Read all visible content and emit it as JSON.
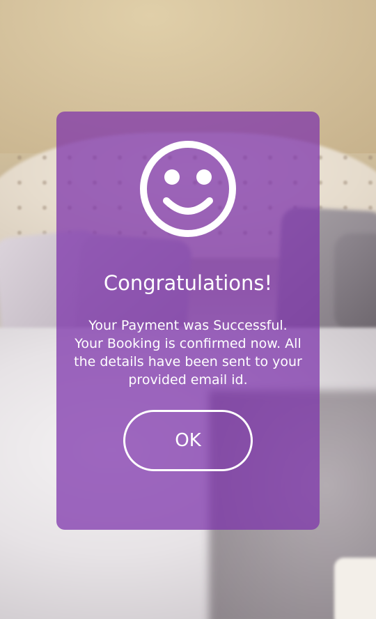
{
  "dialog": {
    "icon": "smiley-face-icon",
    "title": "Congratulations!",
    "message_lines": [
      "Your Payment was Successful.",
      "Your Booking is confirmed now. All",
      "the details have been sent to your",
      "provided email id."
    ],
    "ok_label": "OK"
  },
  "colors": {
    "overlay": "#7b30aa",
    "text": "#ffffff"
  }
}
